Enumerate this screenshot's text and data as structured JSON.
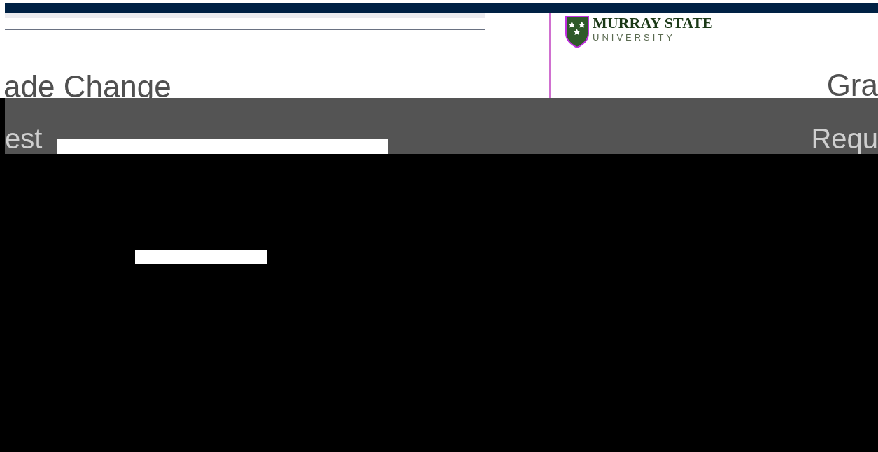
{
  "left_pane": {
    "heading": "ade Change",
    "subheading": "est"
  },
  "right_pane": {
    "logo": {
      "name": "MURRAY STATE",
      "subtitle": "UNIVERSITY"
    },
    "heading": "Gra",
    "subheading": "Requ"
  }
}
